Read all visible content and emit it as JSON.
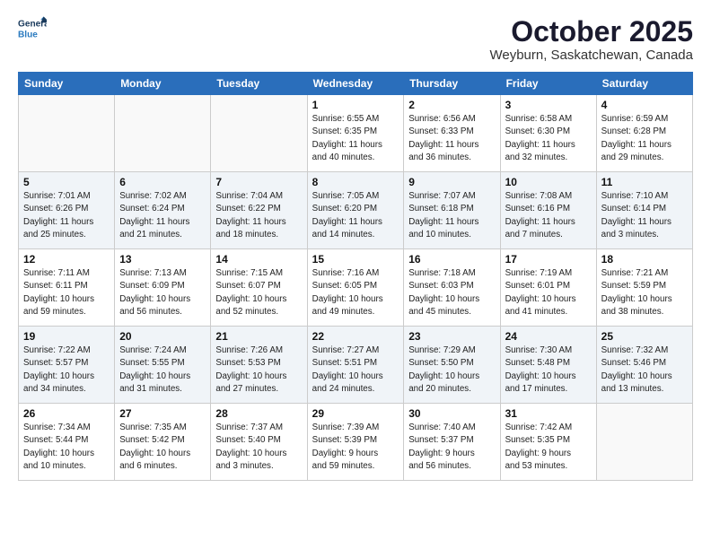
{
  "header": {
    "logo_line1": "General",
    "logo_line2": "Blue",
    "month_title": "October 2025",
    "location": "Weyburn, Saskatchewan, Canada"
  },
  "weekdays": [
    "Sunday",
    "Monday",
    "Tuesday",
    "Wednesday",
    "Thursday",
    "Friday",
    "Saturday"
  ],
  "weeks": [
    [
      {
        "day": "",
        "info": ""
      },
      {
        "day": "",
        "info": ""
      },
      {
        "day": "",
        "info": ""
      },
      {
        "day": "1",
        "info": "Sunrise: 6:55 AM\nSunset: 6:35 PM\nDaylight: 11 hours\nand 40 minutes."
      },
      {
        "day": "2",
        "info": "Sunrise: 6:56 AM\nSunset: 6:33 PM\nDaylight: 11 hours\nand 36 minutes."
      },
      {
        "day": "3",
        "info": "Sunrise: 6:58 AM\nSunset: 6:30 PM\nDaylight: 11 hours\nand 32 minutes."
      },
      {
        "day": "4",
        "info": "Sunrise: 6:59 AM\nSunset: 6:28 PM\nDaylight: 11 hours\nand 29 minutes."
      }
    ],
    [
      {
        "day": "5",
        "info": "Sunrise: 7:01 AM\nSunset: 6:26 PM\nDaylight: 11 hours\nand 25 minutes."
      },
      {
        "day": "6",
        "info": "Sunrise: 7:02 AM\nSunset: 6:24 PM\nDaylight: 11 hours\nand 21 minutes."
      },
      {
        "day": "7",
        "info": "Sunrise: 7:04 AM\nSunset: 6:22 PM\nDaylight: 11 hours\nand 18 minutes."
      },
      {
        "day": "8",
        "info": "Sunrise: 7:05 AM\nSunset: 6:20 PM\nDaylight: 11 hours\nand 14 minutes."
      },
      {
        "day": "9",
        "info": "Sunrise: 7:07 AM\nSunset: 6:18 PM\nDaylight: 11 hours\nand 10 minutes."
      },
      {
        "day": "10",
        "info": "Sunrise: 7:08 AM\nSunset: 6:16 PM\nDaylight: 11 hours\nand 7 minutes."
      },
      {
        "day": "11",
        "info": "Sunrise: 7:10 AM\nSunset: 6:14 PM\nDaylight: 11 hours\nand 3 minutes."
      }
    ],
    [
      {
        "day": "12",
        "info": "Sunrise: 7:11 AM\nSunset: 6:11 PM\nDaylight: 10 hours\nand 59 minutes."
      },
      {
        "day": "13",
        "info": "Sunrise: 7:13 AM\nSunset: 6:09 PM\nDaylight: 10 hours\nand 56 minutes."
      },
      {
        "day": "14",
        "info": "Sunrise: 7:15 AM\nSunset: 6:07 PM\nDaylight: 10 hours\nand 52 minutes."
      },
      {
        "day": "15",
        "info": "Sunrise: 7:16 AM\nSunset: 6:05 PM\nDaylight: 10 hours\nand 49 minutes."
      },
      {
        "day": "16",
        "info": "Sunrise: 7:18 AM\nSunset: 6:03 PM\nDaylight: 10 hours\nand 45 minutes."
      },
      {
        "day": "17",
        "info": "Sunrise: 7:19 AM\nSunset: 6:01 PM\nDaylight: 10 hours\nand 41 minutes."
      },
      {
        "day": "18",
        "info": "Sunrise: 7:21 AM\nSunset: 5:59 PM\nDaylight: 10 hours\nand 38 minutes."
      }
    ],
    [
      {
        "day": "19",
        "info": "Sunrise: 7:22 AM\nSunset: 5:57 PM\nDaylight: 10 hours\nand 34 minutes."
      },
      {
        "day": "20",
        "info": "Sunrise: 7:24 AM\nSunset: 5:55 PM\nDaylight: 10 hours\nand 31 minutes."
      },
      {
        "day": "21",
        "info": "Sunrise: 7:26 AM\nSunset: 5:53 PM\nDaylight: 10 hours\nand 27 minutes."
      },
      {
        "day": "22",
        "info": "Sunrise: 7:27 AM\nSunset: 5:51 PM\nDaylight: 10 hours\nand 24 minutes."
      },
      {
        "day": "23",
        "info": "Sunrise: 7:29 AM\nSunset: 5:50 PM\nDaylight: 10 hours\nand 20 minutes."
      },
      {
        "day": "24",
        "info": "Sunrise: 7:30 AM\nSunset: 5:48 PM\nDaylight: 10 hours\nand 17 minutes."
      },
      {
        "day": "25",
        "info": "Sunrise: 7:32 AM\nSunset: 5:46 PM\nDaylight: 10 hours\nand 13 minutes."
      }
    ],
    [
      {
        "day": "26",
        "info": "Sunrise: 7:34 AM\nSunset: 5:44 PM\nDaylight: 10 hours\nand 10 minutes."
      },
      {
        "day": "27",
        "info": "Sunrise: 7:35 AM\nSunset: 5:42 PM\nDaylight: 10 hours\nand 6 minutes."
      },
      {
        "day": "28",
        "info": "Sunrise: 7:37 AM\nSunset: 5:40 PM\nDaylight: 10 hours\nand 3 minutes."
      },
      {
        "day": "29",
        "info": "Sunrise: 7:39 AM\nSunset: 5:39 PM\nDaylight: 9 hours\nand 59 minutes."
      },
      {
        "day": "30",
        "info": "Sunrise: 7:40 AM\nSunset: 5:37 PM\nDaylight: 9 hours\nand 56 minutes."
      },
      {
        "day": "31",
        "info": "Sunrise: 7:42 AM\nSunset: 5:35 PM\nDaylight: 9 hours\nand 53 minutes."
      },
      {
        "day": "",
        "info": ""
      }
    ]
  ]
}
